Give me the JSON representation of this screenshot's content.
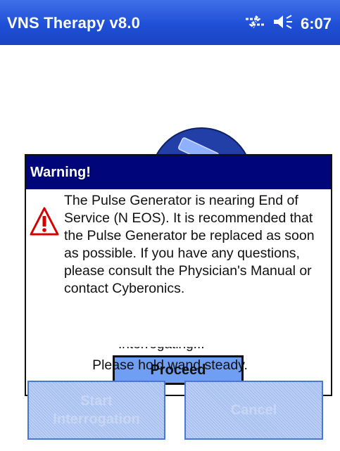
{
  "titlebar": {
    "app_title": "VNS Therapy v8.0",
    "connectivity_icon": "connectivity-arrows-icon",
    "volume_icon": "speaker-volume-icon",
    "time": "6:07"
  },
  "dialog": {
    "title": "Warning!",
    "icon": "warning-triangle-icon",
    "message": "The Pulse Generator is nearing End of Service (N EOS). It is recommended that the Pulse Generator be replaced as soon as possible. If you have any questions, please consult the Physician's Manual or contact Cyberonics.",
    "proceed_label": "Proceed"
  },
  "status": {
    "partial_line": "Interrogating...",
    "hold_message": "Please hold wand steady."
  },
  "buttons": {
    "start_line1": "Start",
    "start_line2": "Interrogation",
    "cancel": "Cancel"
  },
  "colors": {
    "titlebar": "#1f4fd6",
    "dialog_title": "#00067a",
    "proceed": "#6f9ef2",
    "disabled_button": "#a8c1f1",
    "warning_red": "#d40000"
  }
}
